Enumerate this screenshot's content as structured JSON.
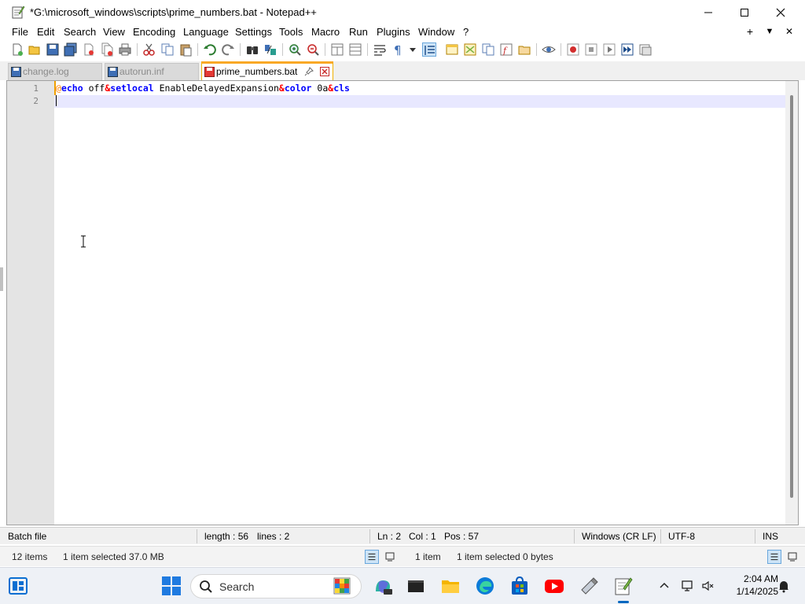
{
  "window": {
    "title": "*G:\\microsoft_windows\\scripts\\prime_numbers.bat - Notepad++",
    "minimize": "minimize-icon",
    "maximize": "maximize-icon",
    "close": "close-icon"
  },
  "menu": {
    "items": [
      "File",
      "Edit",
      "Search",
      "View",
      "Encoding",
      "Language",
      "Settings",
      "Tools",
      "Macro",
      "Run",
      "Plugins",
      "Window",
      "?"
    ],
    "right": [
      "+",
      "▼",
      "✕"
    ]
  },
  "tabs": [
    {
      "label": "change.log",
      "active": false
    },
    {
      "label": "autorun.inf",
      "active": false
    },
    {
      "label": "prime_numbers.bat",
      "active": true
    }
  ],
  "editor": {
    "line_numbers": [
      "1",
      "2"
    ],
    "tokens": [
      {
        "text": "@",
        "color": "#ff8000"
      },
      {
        "text": "echo",
        "color": "#0000ff"
      },
      {
        "text": " off",
        "color": "#000000"
      },
      {
        "text": "&",
        "color": "#ff0000"
      },
      {
        "text": "setlocal",
        "color": "#0000ff"
      },
      {
        "text": " EnableDelayedExpansion",
        "color": "#000000"
      },
      {
        "text": "&",
        "color": "#ff0000"
      },
      {
        "text": "color",
        "color": "#0000ff"
      },
      {
        "text": " 0a",
        "color": "#000000"
      },
      {
        "text": "&",
        "color": "#ff0000"
      },
      {
        "text": "cls",
        "color": "#0000ff"
      }
    ]
  },
  "status": {
    "file_type": "Batch file",
    "length": "length : 56",
    "lines": "lines : 2",
    "ln": "Ln : 2",
    "col": "Col : 1",
    "pos": "Pos : 57",
    "eol": "Windows (CR LF)",
    "encoding": "UTF-8",
    "mode": "INS"
  },
  "explorer": {
    "left_count": "12 items",
    "left_selected": "1 item selected  37.0 MB",
    "right_count": "1 item",
    "right_selected": "1 item selected  0 bytes"
  },
  "taskbar": {
    "search_label": "Search",
    "time": "2:04 AM",
    "date": "1/14/2025"
  },
  "colors": {
    "tab_accent": "#f9a825",
    "current_line": "#e8e8ff",
    "gutter": "#e4e4e4"
  }
}
